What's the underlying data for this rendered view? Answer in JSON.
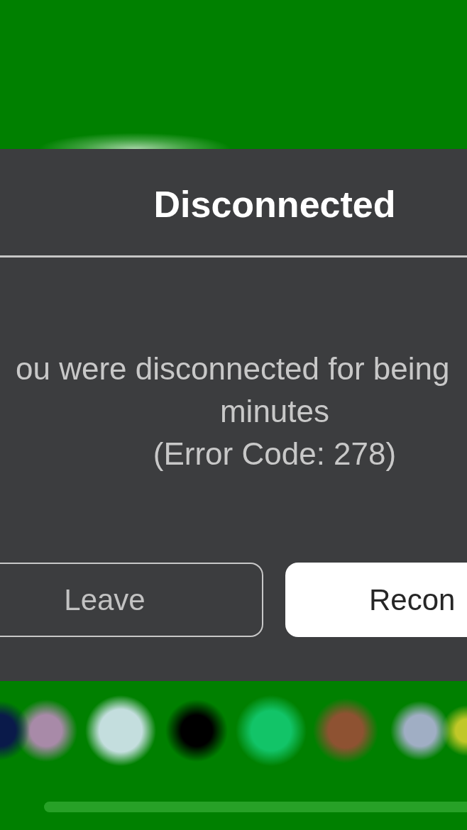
{
  "dialog": {
    "title": "Disconnected",
    "message_lines": [
      "ou were disconnected for being",
      "minutes"
    ],
    "error_code": "(Error Code: 278)",
    "buttons": [
      {
        "label": "Leave",
        "kind": "secondary"
      },
      {
        "label": "Recon",
        "kind": "primary"
      }
    ]
  }
}
